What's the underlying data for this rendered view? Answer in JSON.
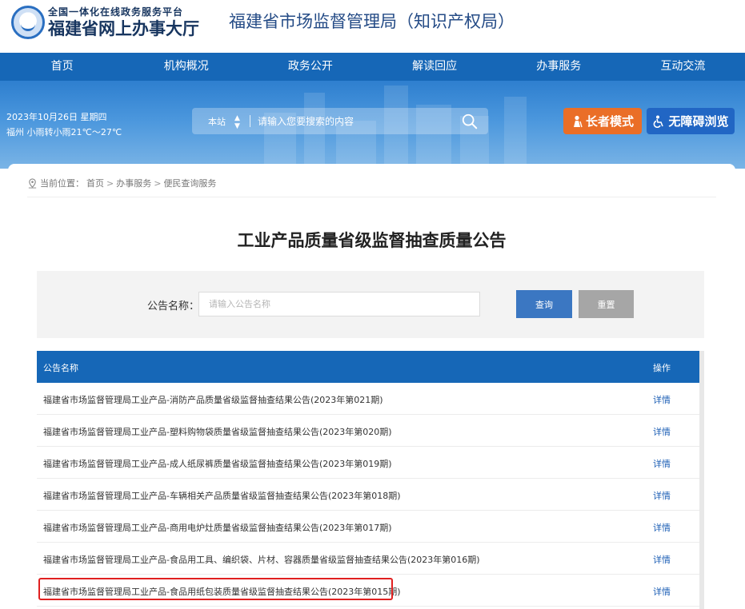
{
  "header": {
    "logo_line1": "全国一体化在线政务服务平台",
    "logo_line2": "福建省网上办事大厅",
    "dept_title": "福建省市场监督管理局（知识产权局）"
  },
  "nav": {
    "items": [
      "首页",
      "机构概况",
      "政务公开",
      "解读回应",
      "办事服务",
      "互动交流"
    ]
  },
  "banner": {
    "date": "2023年10月26日 星期四",
    "weather": "福州 小雨转小雨21℃～27℃",
    "search_scope": "本站",
    "search_placeholder": "请输入您要搜索的内容",
    "elder_mode": "长者模式",
    "accessible": "无障碍浏览",
    "colors": {
      "elder": "#ea6e27",
      "accessible": "#2166c4",
      "nav": "#1667b7"
    }
  },
  "breadcrumb": {
    "prefix": "当前位置：",
    "items": [
      "首页",
      "办事服务",
      "便民查询服务"
    ]
  },
  "page_title": "工业产品质量省级监督抽查质量公告",
  "filter": {
    "label": "公告名称：",
    "placeholder": "请输入公告名称",
    "query_button": "查询",
    "reset_button": "重置"
  },
  "table": {
    "headers": {
      "name": "公告名称",
      "op": "操作"
    },
    "rows": [
      {
        "name": "福建省市场监督管理局工业产品-消防产品质量省级监督抽查结果公告(2023年第021期)",
        "op": "详情"
      },
      {
        "name": "福建省市场监督管理局工业产品-塑料购物袋质量省级监督抽查结果公告(2023年第020期)",
        "op": "详情"
      },
      {
        "name": "福建省市场监督管理局工业产品-成人纸尿裤质量省级监督抽查结果公告(2023年第019期)",
        "op": "详情"
      },
      {
        "name": "福建省市场监督管理局工业产品-车辆相关产品质量省级监督抽查结果公告(2023年第018期)",
        "op": "详情"
      },
      {
        "name": "福建省市场监督管理局工业产品-商用电炉灶质量省级监督抽查结果公告(2023年第017期)",
        "op": "详情"
      },
      {
        "name": "福建省市场监督管理局工业产品-食品用工具、编织袋、片材、容器质量省级监督抽查结果公告(2023年第016期)",
        "op": "详情"
      },
      {
        "name": "福建省市场监督管理局工业产品-食品用纸包装质量省级监督抽查结果公告(2023年第015期)",
        "op": "详情"
      }
    ]
  }
}
